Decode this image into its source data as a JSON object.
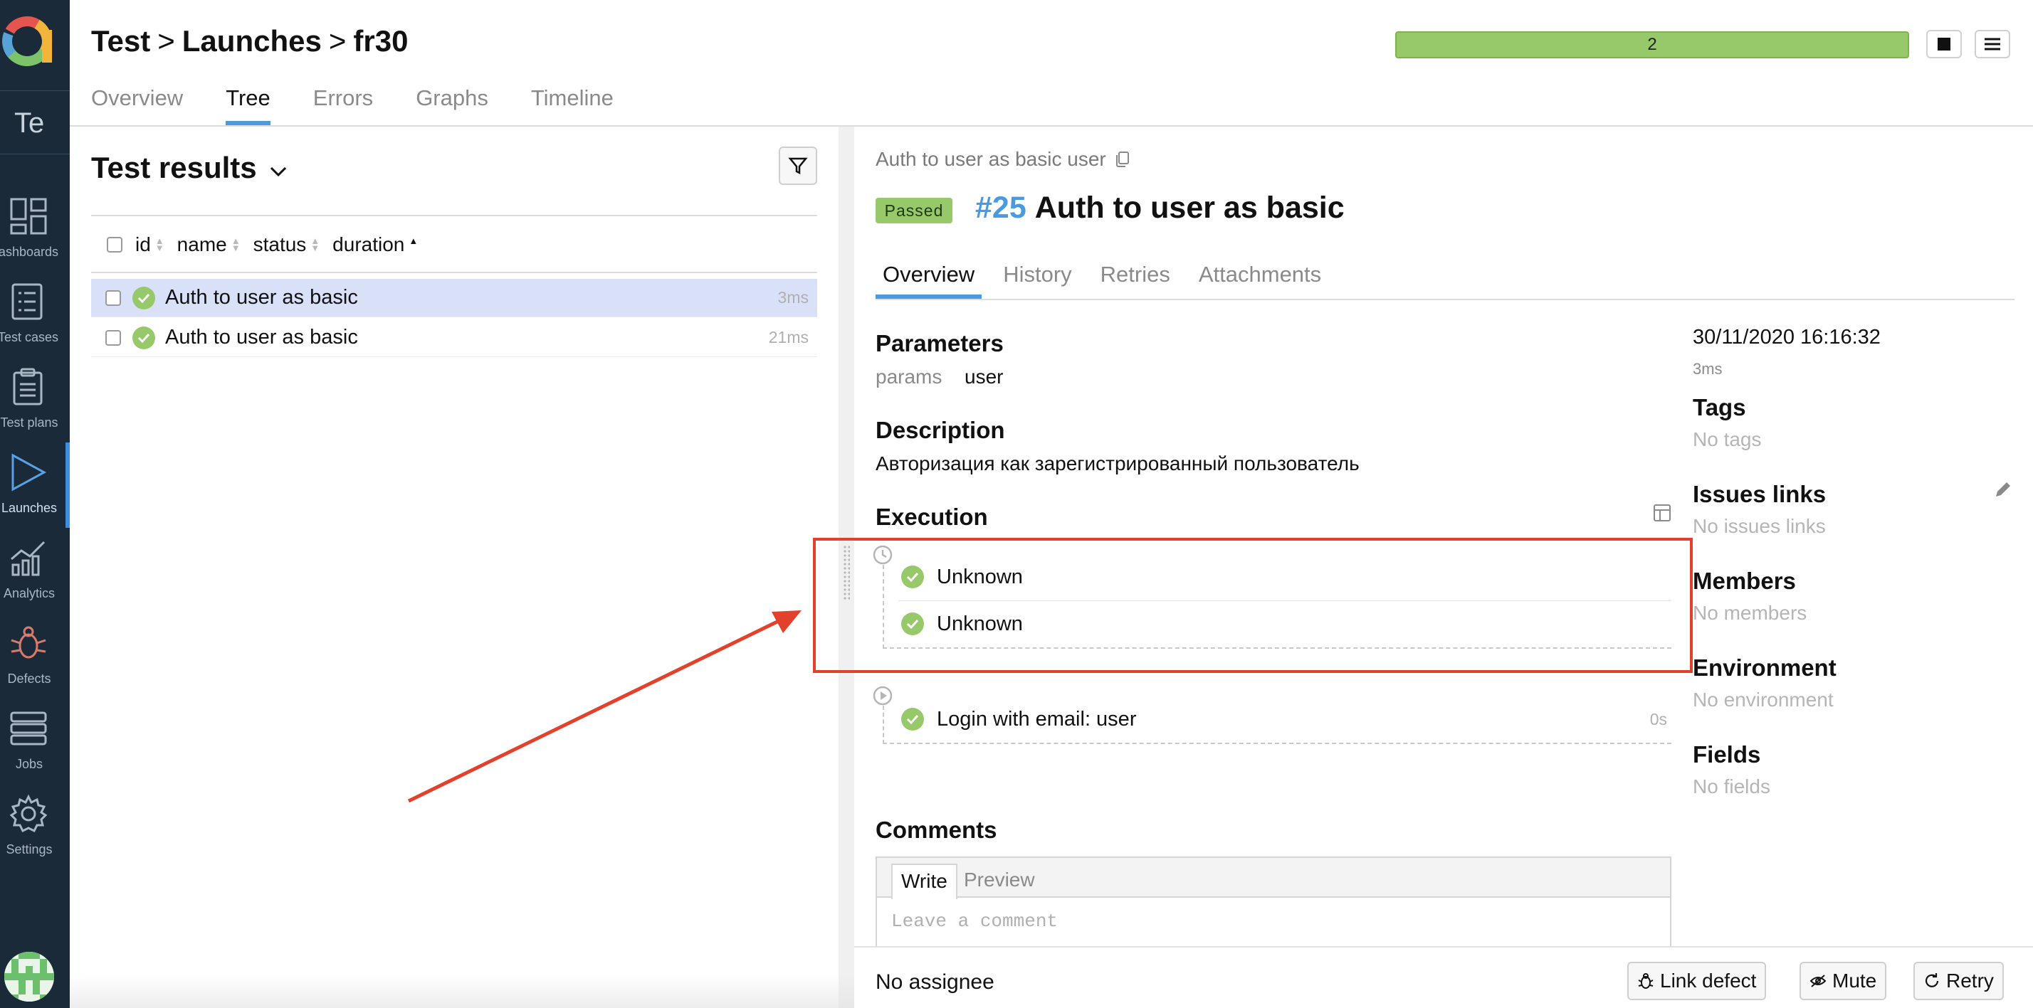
{
  "sidebar": {
    "project_abbr": "Te",
    "items": [
      {
        "label": "Dashboards",
        "icon": "dashboards-icon"
      },
      {
        "label": "Test cases",
        "icon": "test-cases-icon"
      },
      {
        "label": "Test plans",
        "icon": "test-plans-icon"
      },
      {
        "label": "Launches",
        "icon": "launches-icon",
        "active": true
      },
      {
        "label": "Analytics",
        "icon": "analytics-icon"
      },
      {
        "label": "Defects",
        "icon": "bug-icon"
      },
      {
        "label": "Jobs",
        "icon": "jobs-icon"
      },
      {
        "label": "Settings",
        "icon": "gear-icon"
      }
    ]
  },
  "header": {
    "breadcrumb": [
      "Test",
      "Launches",
      "fr30"
    ],
    "breadcrumb_separator": ">",
    "tabs": [
      "Overview",
      "Tree",
      "Errors",
      "Graphs",
      "Timeline"
    ],
    "active_tab": "Tree",
    "progress_label": "2",
    "colors": {
      "progress": "#97c96b",
      "accent": "#4a9ae0"
    }
  },
  "results": {
    "title": "Test results",
    "columns": [
      "id",
      "name",
      "status",
      "duration"
    ],
    "rows": [
      {
        "name": "Auth to user as basic",
        "duration": "3ms",
        "selected": true
      },
      {
        "name": "Auth to user as basic",
        "duration": "21ms",
        "selected": false
      }
    ]
  },
  "testcase": {
    "path": "Auth to user as basic user",
    "status": "Passed",
    "number": "#25",
    "title": "Auth to user as basic",
    "tabs": [
      "Overview",
      "History",
      "Retries",
      "Attachments"
    ],
    "active_tab": "Overview",
    "parameters_heading": "Parameters",
    "param_name": "params",
    "param_value": "user",
    "description_heading": "Description",
    "description": "Авторизация как зарегистрированный пользователь",
    "execution_heading": "Execution",
    "setup_steps": [
      "Unknown",
      "Unknown"
    ],
    "body_steps": [
      {
        "name": "Login with email: user",
        "duration": "0s"
      }
    ],
    "comments_heading": "Comments",
    "comment_tabs": [
      "Write",
      "Preview"
    ],
    "comment_placeholder": "Leave a comment"
  },
  "meta": {
    "date": "30/11/2020 16:16:32",
    "duration": "3ms",
    "tags_heading": "Tags",
    "tags_empty": "No tags",
    "issues_heading": "Issues links",
    "issues_empty": "No issues links",
    "members_heading": "Members",
    "members_empty": "No members",
    "environment_heading": "Environment",
    "environment_empty": "No environment",
    "fields_heading": "Fields",
    "fields_empty": "No fields"
  },
  "footer": {
    "assignee": "No assignee",
    "link_defect": "Link defect",
    "mute": "Mute",
    "retry": "Retry"
  },
  "annotation": {
    "color": "#e3412b"
  }
}
